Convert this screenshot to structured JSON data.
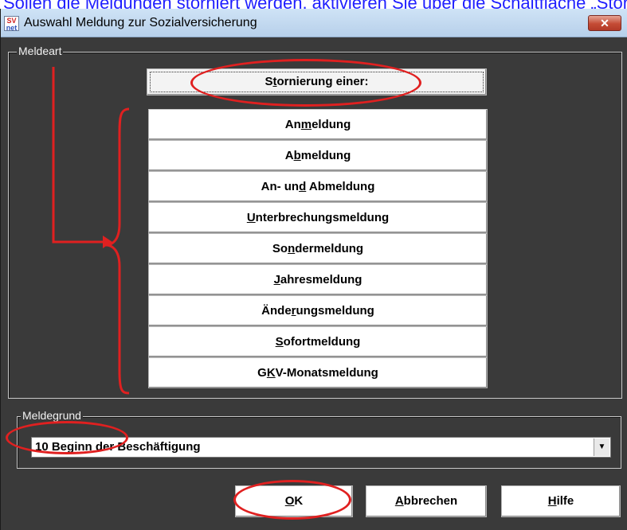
{
  "page_header_text": "Sollen die Meldungen storniert werden, aktivieren Sie über die Schaltfläche „Stornierung einer:“",
  "window": {
    "title": "Auswahl Meldung zur Sozialversicherung",
    "icon_top": "SV",
    "icon_bottom": "net",
    "close_glyph": "✕"
  },
  "meldeart": {
    "label": "Meldeart",
    "storno_button": {
      "pre": "S",
      "key": "t",
      "post": "ornierung einer:"
    },
    "types": [
      {
        "pre": "An",
        "key": "m",
        "post": "eldung"
      },
      {
        "pre": "A",
        "key": "b",
        "post": "meldung"
      },
      {
        "pre": "An- un",
        "key": "d",
        "post": " Abmeldung"
      },
      {
        "pre": "",
        "key": "U",
        "post": "nterbrechungsmeldung"
      },
      {
        "pre": "So",
        "key": "n",
        "post": "dermeldung"
      },
      {
        "pre": "",
        "key": "J",
        "post": "ahresmeldung"
      },
      {
        "pre": "Ände",
        "key": "r",
        "post": "ungsmeldung"
      },
      {
        "pre": "",
        "key": "S",
        "post": "ofortmeldung"
      },
      {
        "pre": "G",
        "key": "K",
        "post": "V-Monatsmeldung"
      }
    ]
  },
  "meldegrund": {
    "label": "Meldegrund",
    "selected_value": "10 Beginn der Beschäftigung",
    "arrow_glyph": "▼"
  },
  "actions": {
    "ok": {
      "pre": "",
      "key": "O",
      "post": "K"
    },
    "cancel": {
      "pre": "",
      "key": "A",
      "post": "bbrechen"
    },
    "help": {
      "pre": "",
      "key": "H",
      "post": "ilfe"
    }
  },
  "colors": {
    "annotation_red": "#e02020",
    "window_bg": "#3a3a3a",
    "titlebar": "#c5dbf1",
    "close_button": "#c44b35"
  }
}
